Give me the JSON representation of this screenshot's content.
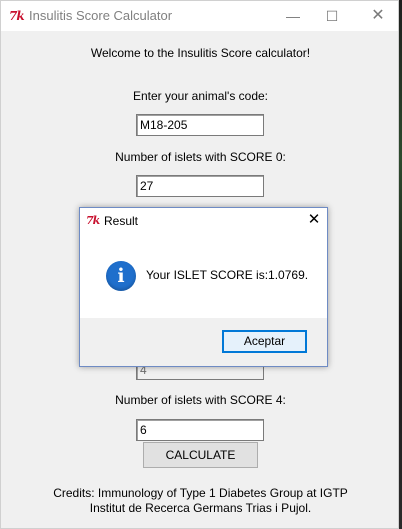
{
  "window": {
    "title": "Insulitis Score Calculator",
    "icon_text": "7k",
    "controls": {
      "minimize": "—",
      "maximize": "☐",
      "close": "✕"
    }
  },
  "main": {
    "welcome": "Welcome to the Insulitis Score calculator!",
    "code_label": "Enter your animal's code:",
    "code_value": "M18-205",
    "score0_label": "Number of islets with SCORE 0:",
    "score0_value": "27",
    "score3_value": "4",
    "score4_label": "Number of islets with SCORE 4:",
    "score4_value": "6",
    "calculate_label": "CALCULATE",
    "credits_line1": "Credits: Immunology of Type 1 Diabetes Group at IGTP",
    "credits_line2": "Institut de Recerca Germans Trias i Pujol."
  },
  "dialog": {
    "title": "Result",
    "icon_text": "7k",
    "close": "✕",
    "info_glyph": "i",
    "message": "Your ISLET SCORE is:1.0769.",
    "ok_label": "Aceptar"
  },
  "colors": {
    "accent": "#0078d7",
    "info_icon": "#1f6fcc",
    "tk_icon": "#c8102e"
  }
}
